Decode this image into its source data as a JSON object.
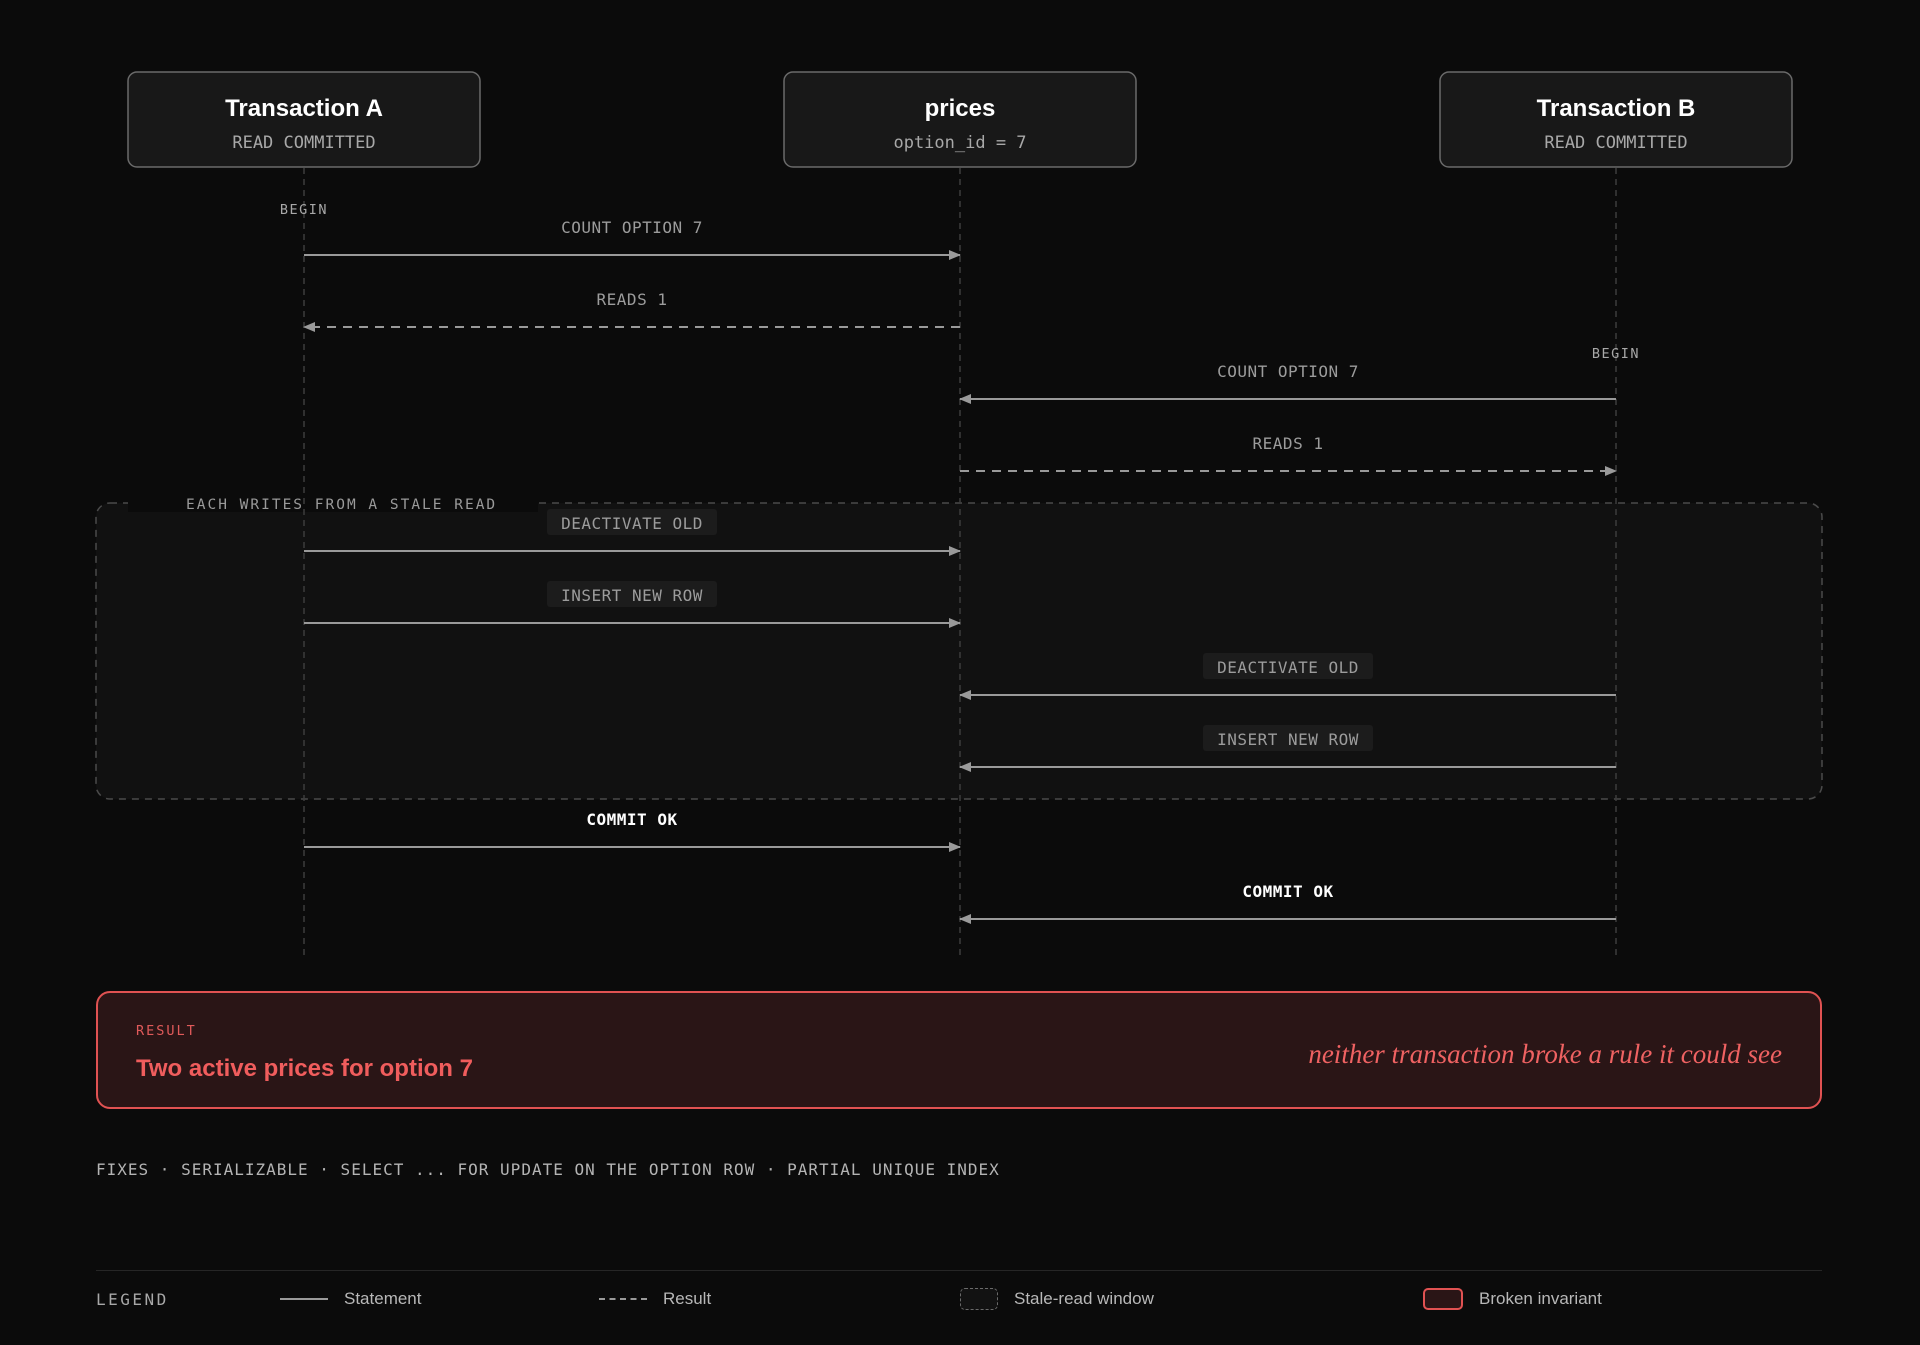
{
  "actors": [
    {
      "title": "Transaction A",
      "subtitle": "READ COMMITTED"
    },
    {
      "title": "prices",
      "subtitle": "option_id = 7"
    },
    {
      "title": "Transaction B",
      "subtitle": "READ COMMITTED"
    }
  ],
  "begin_a": "BEGIN",
  "begin_b": "BEGIN",
  "messages": [
    {
      "label": "COUNT OPTION 7",
      "from": 0,
      "to": 1,
      "kind": "statement",
      "emphasis": false
    },
    {
      "label": "READS 1",
      "from": 1,
      "to": 0,
      "kind": "result",
      "emphasis": false
    },
    {
      "label": "COUNT OPTION 7",
      "from": 2,
      "to": 1,
      "kind": "statement",
      "emphasis": false
    },
    {
      "label": "READS 1",
      "from": 1,
      "to": 2,
      "kind": "result",
      "emphasis": false
    },
    {
      "label": "DEACTIVATE OLD",
      "from": 0,
      "to": 1,
      "kind": "statement",
      "emphasis": false
    },
    {
      "label": "INSERT NEW ROW",
      "from": 0,
      "to": 1,
      "kind": "statement",
      "emphasis": false
    },
    {
      "label": "DEACTIVATE OLD",
      "from": 2,
      "to": 1,
      "kind": "statement",
      "emphasis": false
    },
    {
      "label": "INSERT NEW ROW",
      "from": 2,
      "to": 1,
      "kind": "statement",
      "emphasis": false
    },
    {
      "label": "COMMIT OK",
      "from": 0,
      "to": 1,
      "kind": "statement",
      "emphasis": true
    },
    {
      "label": "COMMIT OK",
      "from": 2,
      "to": 1,
      "kind": "statement",
      "emphasis": true
    }
  ],
  "stale_window": {
    "label": "EACH WRITES FROM A STALE READ"
  },
  "result": {
    "kicker": "RESULT",
    "title": "Two active prices for option 7",
    "note": "neither transaction broke a rule it could see"
  },
  "fixes": "FIXES · SERIALIZABLE · SELECT ... FOR UPDATE ON THE OPTION ROW · PARTIAL UNIQUE INDEX",
  "legend": {
    "title": "LEGEND",
    "statement": "Statement",
    "result": "Result",
    "stale": "Stale-read window",
    "broken": "Broken invariant"
  },
  "colors": {
    "background": "#0b0b0b",
    "arrow": "#9a9a9a",
    "danger": "#e05252",
    "danger_bg": "#2a1516"
  }
}
